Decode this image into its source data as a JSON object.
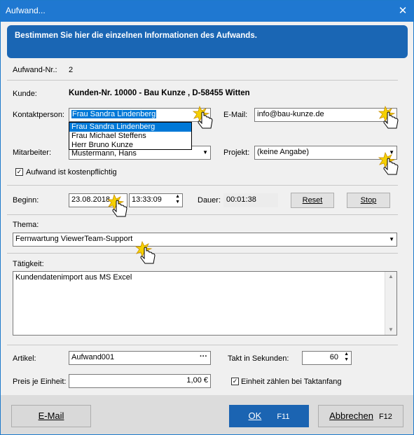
{
  "window": {
    "title": "Aufwand...",
    "close_glyph": "✕"
  },
  "banner": "Bestimmen Sie hier die einzelnen Informationen des Aufwands.",
  "aufwand_nr": {
    "label": "Aufwand-Nr.:",
    "value": "2"
  },
  "kunde": {
    "label": "Kunde:",
    "value": "Kunden-Nr. 10000 - Bau Kunze , D-58455  Witten"
  },
  "kontaktperson": {
    "label": "Kontaktperson:",
    "value": "Frau Sandra Lindenberg",
    "options": [
      "Frau Sandra Lindenberg",
      "Frau Michael Steffens",
      "Herr Bruno Kunze"
    ]
  },
  "email": {
    "label": "E-Mail:",
    "value": "info@bau-kunze.de"
  },
  "mitarbeiter": {
    "label": "Mitarbeiter:",
    "value": "Mustermann, Hans"
  },
  "projekt": {
    "label": "Projekt:",
    "value": "(keine Angabe)"
  },
  "kostenpflichtig": {
    "label": "Aufwand ist kostenpflichtig",
    "checked": true
  },
  "beginn": {
    "label": "Beginn:",
    "date": "23.08.2018",
    "time": "13:33:09"
  },
  "dauer": {
    "label": "Dauer:",
    "value": "00:01:38"
  },
  "buttons": {
    "reset": "Reset",
    "stop": "Stop"
  },
  "thema": {
    "label": "Thema:",
    "value": "Fernwartung ViewerTeam-Support"
  },
  "taetigkeit": {
    "label": "Tätigkeit:",
    "value": "Kundendatenimport aus MS Excel"
  },
  "artikel": {
    "label": "Artikel:",
    "value": "Aufwand001",
    "browse_glyph": "···"
  },
  "takt": {
    "label": "Takt in Sekunden:",
    "value": "60"
  },
  "preis": {
    "label": "Preis je Einheit:",
    "value": "1,00 €"
  },
  "taktanfang": {
    "label": "Einheit zählen bei Taktanfang",
    "checked": true
  },
  "footer": {
    "email": "E-Mail",
    "ok": "OK",
    "ok_key": "F11",
    "cancel": "Abbrechen",
    "cancel_key": "F12"
  },
  "colors": {
    "titlebar": "#1f78d1",
    "banner": "#1a66b4",
    "selection": "#0078d7",
    "primary_button": "#1b64b2"
  }
}
